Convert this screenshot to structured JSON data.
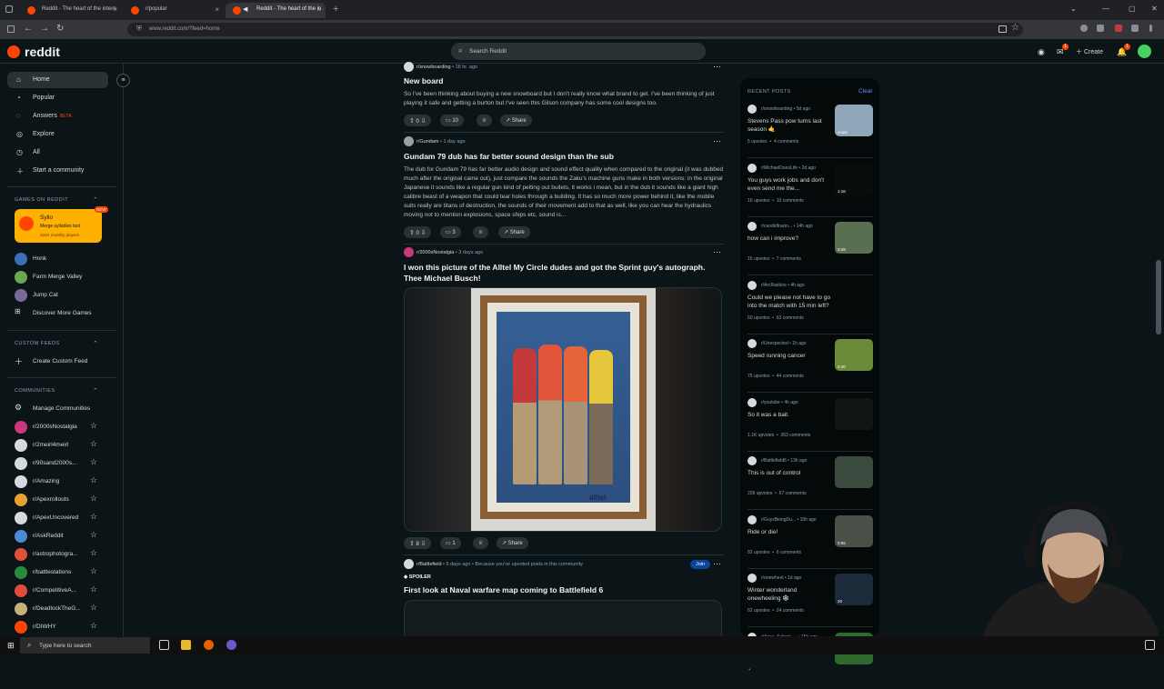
{
  "browser": {
    "tabs": [
      {
        "title": "Reddit - The heart of the intern"
      },
      {
        "title": "r/popular"
      },
      {
        "title": "Reddit - The heart of the in"
      }
    ],
    "new_tab": "+",
    "url": "www.reddit.com/?feed=home"
  },
  "header": {
    "logo_text": "reddit",
    "search_placeholder": "Search Reddit",
    "create_label": "Create",
    "chat_badge": "1",
    "notif_badge": "1"
  },
  "sidebar": {
    "nav": [
      {
        "label": "Home",
        "icon": "home-icon"
      },
      {
        "label": "Popular",
        "icon": "popular-icon"
      },
      {
        "label": "Answers",
        "icon": "answers-icon",
        "badge": "BETA"
      },
      {
        "label": "Explore",
        "icon": "explore-icon"
      },
      {
        "label": "All",
        "icon": "all-icon"
      },
      {
        "label": "Start a community",
        "icon": "plus-icon"
      }
    ],
    "games_header": "GAMES ON REDDIT",
    "promo": {
      "title": "Syllo",
      "subtitle": "Merge syllables fast",
      "players": "334K monthly players",
      "badge": "NEW"
    },
    "games": [
      "Honk",
      "Farm Merge Valley",
      "Jump Cat",
      "Discover More Games"
    ],
    "custom_feeds_header": "CUSTOM FEEDS",
    "create_custom_feed": "Create Custom Feed",
    "communities_header": "COMMUNITIES",
    "manage_communities": "Manage Communities",
    "communities": [
      {
        "name": "r/2000sNostalgia",
        "color": "#c9377d"
      },
      {
        "name": "r/2meirl4meirl",
        "color": "#d7dadc"
      },
      {
        "name": "r/90sand2000s...",
        "color": "#d7dadc"
      },
      {
        "name": "r/Amazing",
        "color": "#d7dadc"
      },
      {
        "name": "r/Apexrollouts",
        "color": "#e8a12e"
      },
      {
        "name": "r/ApexUncovered",
        "color": "#d7dadc"
      },
      {
        "name": "r/AskReddit",
        "color": "#4a8bd6"
      },
      {
        "name": "r/astrophotogra...",
        "color": "#e0503a"
      },
      {
        "name": "r/battlestations",
        "color": "#2a8a3c"
      },
      {
        "name": "r/CompetitiveA...",
        "color": "#e24a3b"
      },
      {
        "name": "r/DeadlockTheG...",
        "color": "#c8b07a"
      },
      {
        "name": "r/DIWHY",
        "color": "#ff4500"
      }
    ]
  },
  "feed": {
    "posts": [
      {
        "subreddit": "r/snowboarding",
        "time": "18 hr. ago",
        "title": "New board",
        "body": "So I've been thinking about buying a new snowboard but I don't really know what brand to get. I've been thinking of just playing it safe and getting a burton but I've seen this Gilson company has some cool designs too.",
        "votes": "0",
        "comments": "10",
        "share": "Share"
      },
      {
        "subreddit": "r/Gundam",
        "time": "1 day ago",
        "title": "Gundam 79 dub has far better sound design than the sub",
        "body": "The dub for Gundam 79 has far better audio design and sound effect quality when compared to the original (it was dubbed much after the original came out), just compare the sounds the Zaku's machine guns make in both versions: in the original Japanese it sounds like a regular gun kind of pelting out bullets, it works i mean, but in the dub it sounds like a giant high calibre beast of a weapon that could tear holes through a building. It has so much more power behind it, like the mobile suits really are titans of destruction, the sounds of their movement add to that as well, like you can hear the hydraulics moving not to mention explosions, space ships etc, sound is...",
        "votes": "0",
        "comments": "3",
        "share": "Share"
      },
      {
        "subreddit": "r/2000sNostalgia",
        "time": "3 days ago",
        "title": "I won this picture of the Alltel My Circle dudes and got the Sprint guy's autograph. Thee Michael Busch!",
        "image_text": "alltel",
        "votes": "8",
        "comments": "1",
        "share": "Share"
      },
      {
        "subreddit": "r/Battlefield",
        "time": "5 days ago",
        "reason": "Because you've upvoted posts in this community",
        "join": "Join",
        "spoiler": "SPOILER",
        "title": "First look at Naval warfare map coming to Battlefield 6"
      }
    ]
  },
  "recent": {
    "header": "RECENT POSTS",
    "clear": "Clear",
    "items": [
      {
        "sub": "r/snowboarding",
        "time": "5d ago",
        "title": "Stevens Pass pow turns last season 🤙",
        "upvotes": "5 upvotes",
        "comments": "4 comments",
        "thumb": "#8fa6b8",
        "overlay": "youtu"
      },
      {
        "sub": "r/MichaelDoesLife",
        "time": "2d ago",
        "title": "You guys work jobs and don't even send me the...",
        "upvotes": "16 upvotes",
        "comments": "10 comments",
        "thumb": "#0a0d0e",
        "overlay": "1:16"
      },
      {
        "sub": "r/candidfracin...",
        "time": "14h ago",
        "title": "how can i improve?",
        "upvotes": "15 upvotes",
        "comments": "7 comments",
        "thumb": "#5a6f52",
        "overlay": "0:49"
      },
      {
        "sub": "r/ArcRaiders",
        "time": "4h ago",
        "title": "Could we please not have to go into the match with 15 min left?",
        "upvotes": "60 upvotes",
        "comments": "63 comments",
        "thumb": "",
        "overlay": ""
      },
      {
        "sub": "r/Unexpected",
        "time": "1h ago",
        "title": "Speed running cancer",
        "upvotes": "75 upvotes",
        "comments": "44 comments",
        "thumb": "#6a8a3a",
        "overlay": "0:30"
      },
      {
        "sub": "r/youtube",
        "time": "4h ago",
        "title": "So it was a bait.",
        "upvotes": "1.1K upvotes",
        "comments": "263 comments",
        "thumb": "#111516",
        "overlay": ""
      },
      {
        "sub": "r/Battlefield6",
        "time": "13h ago",
        "title": "This is out of control",
        "upvotes": "209 upvotes",
        "comments": "67 comments",
        "thumb": "#3a4a3f",
        "overlay": ""
      },
      {
        "sub": "r/GuysBeingDu...",
        "time": "10h ago",
        "title": "Ride or die!",
        "upvotes": "82 upvotes",
        "comments": "6 comments",
        "thumb": "#4a4f48",
        "overlay": "0:55"
      },
      {
        "sub": "r/onewheel",
        "time": "1d ago",
        "title": "Winter wonderland onewheeling ❄️",
        "upvotes": "62 upvotes",
        "comments": "24 comments",
        "thumb": "#1c2a3a",
        "overlay": "20"
      },
      {
        "sub": "r/Apex_School_...",
        "time": "15h ago",
        "title": "",
        "upvotes": "",
        "comments": "",
        "thumb": "#2e6a2e",
        "overlay": ""
      }
    ]
  },
  "taskbar": {
    "search_placeholder": "Type here to search"
  },
  "colors": {
    "accent": "#ff4500",
    "bg": "#0b1416",
    "link": "#648efc"
  }
}
